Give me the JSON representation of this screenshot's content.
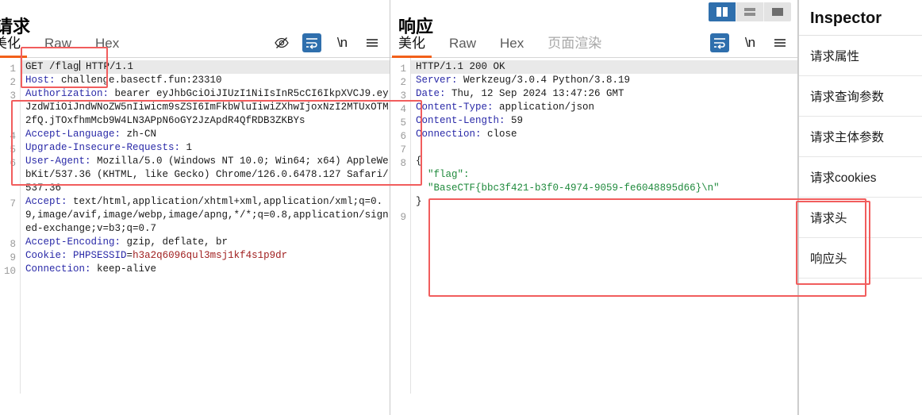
{
  "window_controls": [
    {
      "name": "split-vertical",
      "active": true
    },
    {
      "name": "split-horizontal",
      "active": false
    },
    {
      "name": "single-pane",
      "active": false
    }
  ],
  "request": {
    "title": "请求",
    "tabs": [
      {
        "label": "美化",
        "active": true
      },
      {
        "label": "Raw",
        "active": false
      },
      {
        "label": "Hex",
        "active": false
      }
    ],
    "tools": [
      {
        "name": "eye-off-icon",
        "boxed": false
      },
      {
        "name": "word-wrap-icon",
        "boxed": true
      },
      {
        "name": "newline-icon",
        "boxed": false,
        "label": "\\n"
      },
      {
        "name": "menu-icon",
        "boxed": false
      }
    ],
    "lines": [
      {
        "num": "1",
        "segments": [
          {
            "text": "GET /flag",
            "cls": "plain"
          },
          {
            "caret": true
          },
          {
            "text": " HTTP/1.1",
            "cls": "plain"
          }
        ],
        "first": true
      },
      {
        "num": "2",
        "segments": [
          {
            "text": "Host:",
            "cls": "hdr-name"
          },
          {
            "text": " challenge.basectf.fun:23310",
            "cls": "plain"
          }
        ]
      },
      {
        "num": "3",
        "segments": [
          {
            "text": "Authorization:",
            "cls": "hdr-name"
          },
          {
            "text": " bearer eyJhbGciOiJIUzI1NiIsInR5cCI6IkpXVCJ9.eyJzdWIiOiJndWNoZW5nIiwicm9sZSI6ImFkbWluIiwiZXhwIjoxNzI2MTUxOTM2fQ.jTOxfhmMcb9W4LN3APpN6oGY2JzApdR4QfRDB3ZKBYs",
            "cls": "plain"
          }
        ]
      },
      {
        "num": "4",
        "segments": [
          {
            "text": "Accept-Language:",
            "cls": "hdr-name"
          },
          {
            "text": " zh-CN",
            "cls": "plain"
          }
        ]
      },
      {
        "num": "5",
        "segments": [
          {
            "text": "Upgrade-Insecure-Requests:",
            "cls": "hdr-name"
          },
          {
            "text": " 1",
            "cls": "plain"
          }
        ]
      },
      {
        "num": "6",
        "segments": [
          {
            "text": "User-Agent:",
            "cls": "hdr-name"
          },
          {
            "text": " Mozilla/5.0 (Windows NT 10.0; Win64; x64) AppleWebKit/537.36 (KHTML, like Gecko) Chrome/126.0.6478.127 Safari/537.36",
            "cls": "plain"
          }
        ]
      },
      {
        "num": "7",
        "segments": [
          {
            "text": "Accept:",
            "cls": "hdr-name"
          },
          {
            "text": " text/html,application/xhtml+xml,application/xml;q=0.9,image/avif,image/webp,image/apng,*/*;q=0.8,application/signed-exchange;v=b3;q=0.7",
            "cls": "plain"
          }
        ]
      },
      {
        "num": "8",
        "segments": [
          {
            "text": "Accept-Encoding:",
            "cls": "hdr-name"
          },
          {
            "text": " gzip, deflate, br",
            "cls": "plain"
          }
        ]
      },
      {
        "num": "9",
        "segments": [
          {
            "text": "Cookie:",
            "cls": "hdr-name"
          },
          {
            "text": " ",
            "cls": "plain"
          },
          {
            "text": "PHPSESSID",
            "cls": "hdr-name"
          },
          {
            "text": "=",
            "cls": "plain"
          },
          {
            "text": "h3a2q6096qul3msj1kf4s1p9dr",
            "cls": "cookie-val"
          }
        ]
      },
      {
        "num": "10",
        "segments": [
          {
            "text": "Connection:",
            "cls": "hdr-name"
          },
          {
            "text": " keep-alive",
            "cls": "plain"
          }
        ]
      }
    ]
  },
  "response": {
    "title": "响应",
    "tabs": [
      {
        "label": "美化",
        "active": true
      },
      {
        "label": "Raw",
        "active": false
      },
      {
        "label": "Hex",
        "active": false
      },
      {
        "label": "页面渲染",
        "active": false,
        "dim": true
      }
    ],
    "tools": [
      {
        "name": "word-wrap-icon",
        "boxed": true
      },
      {
        "name": "newline-icon",
        "boxed": false,
        "label": "\\n"
      },
      {
        "name": "menu-icon",
        "boxed": false
      }
    ],
    "lines": [
      {
        "num": "1",
        "segments": [
          {
            "text": "HTTP/1.1 200 OK",
            "cls": "plain"
          }
        ],
        "first": true
      },
      {
        "num": "2",
        "segments": [
          {
            "text": "Server:",
            "cls": "hdr-name"
          },
          {
            "text": " Werkzeug/3.0.4 Python/3.8.19",
            "cls": "plain"
          }
        ]
      },
      {
        "num": "3",
        "segments": [
          {
            "text": "Date:",
            "cls": "hdr-name"
          },
          {
            "text": " Thu, 12 Sep 2024 13:47:26 GMT",
            "cls": "plain"
          }
        ]
      },
      {
        "num": "4",
        "segments": [
          {
            "text": "Content-Type:",
            "cls": "hdr-name"
          },
          {
            "text": " application/json",
            "cls": "plain"
          }
        ]
      },
      {
        "num": "5",
        "segments": [
          {
            "text": "Content-Length:",
            "cls": "hdr-name"
          },
          {
            "text": " 59",
            "cls": "plain"
          }
        ]
      },
      {
        "num": "6",
        "segments": [
          {
            "text": "Connection:",
            "cls": "hdr-name"
          },
          {
            "text": " close",
            "cls": "plain"
          }
        ]
      },
      {
        "num": "7",
        "segments": [
          {
            "text": "",
            "cls": "plain"
          }
        ]
      },
      {
        "num": "8",
        "segments": [
          {
            "text": "{",
            "cls": "plain"
          }
        ]
      },
      {
        "num": "",
        "segments": [
          {
            "text": "  \"flag\": ",
            "cls": "flagtext"
          }
        ]
      },
      {
        "num": "",
        "segments": [
          {
            "text": "  \"BaseCTF{bbc3f421-b3f0-4974-9059-fe6048895d66}\\n\"",
            "cls": "flagtext"
          }
        ]
      },
      {
        "num": "",
        "segments": [
          {
            "text": "}",
            "cls": "plain"
          }
        ]
      },
      {
        "num": "9",
        "segments": [
          {
            "text": "",
            "cls": "plain"
          }
        ]
      }
    ]
  },
  "inspector": {
    "title": "Inspector",
    "items": [
      {
        "label": "请求属性"
      },
      {
        "label": "请求查询参数"
      },
      {
        "label": "请求主体参数"
      },
      {
        "label": "请求cookies"
      },
      {
        "label": "请求头"
      },
      {
        "label": "响应头"
      }
    ]
  }
}
